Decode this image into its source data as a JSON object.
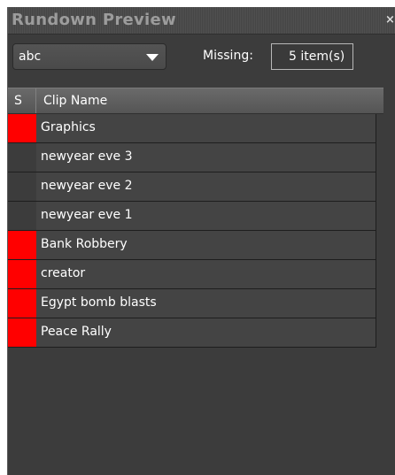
{
  "window": {
    "title": "Rundown Preview",
    "close_glyph": "×"
  },
  "filter": {
    "selected": "abc"
  },
  "missing": {
    "label": "Missing:",
    "value": "5 item(s)"
  },
  "table": {
    "columns": {
      "status": "S",
      "name": "Clip Name"
    },
    "rows": [
      {
        "status": "red",
        "name": "Graphics"
      },
      {
        "status": "none",
        "name": "newyear eve 3"
      },
      {
        "status": "none",
        "name": "newyear eve 2"
      },
      {
        "status": "none",
        "name": "newyear eve 1"
      },
      {
        "status": "red",
        "name": "Bank Robbery"
      },
      {
        "status": "red",
        "name": "creator"
      },
      {
        "status": "red",
        "name": "Egypt bomb blasts"
      },
      {
        "status": "red",
        "name": "Peace Rally"
      }
    ]
  },
  "colors": {
    "status_missing": "#ff0000",
    "panel_bg": "#3c3c3c"
  }
}
